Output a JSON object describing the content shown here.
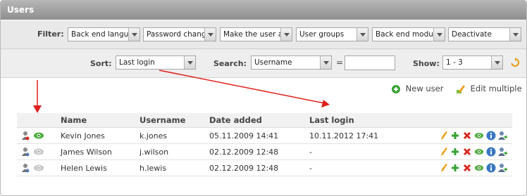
{
  "window": {
    "title": "Users"
  },
  "filter": {
    "label": "Filter:",
    "selects": [
      {
        "value": "Back end langua"
      },
      {
        "value": "Password change"
      },
      {
        "value": "Make the user a"
      },
      {
        "value": "User groups"
      },
      {
        "value": "Back end module"
      },
      {
        "value": "Deactivate"
      }
    ]
  },
  "sort": {
    "label": "Sort:",
    "value": "Last login"
  },
  "search": {
    "label": "Search:",
    "field_value": "Username",
    "equals": "=",
    "query": ""
  },
  "show": {
    "label": "Show:",
    "value": "1 - 3"
  },
  "actions": {
    "new_user": "New user",
    "edit_multiple": "Edit multiple"
  },
  "table": {
    "headers": [
      "Name",
      "Username",
      "Date added",
      "Last login"
    ],
    "rows": [
      {
        "name": "Kevin Jones",
        "username": "k.jones",
        "date_added": "05.11.2009 14:41",
        "last_login": "10.11.2012 17:41",
        "visible": true
      },
      {
        "name": "James Wilson",
        "username": "j.wilson",
        "date_added": "02.12.2009 12:48",
        "last_login": "-",
        "visible": false
      },
      {
        "name": "Helen Lewis",
        "username": "h.lewis",
        "date_added": "02.12.2009 12:48",
        "last_login": "-",
        "visible": false
      }
    ]
  },
  "colors": {
    "arrow": "#e0201c",
    "add": "#3aa335",
    "delete": "#d62b20",
    "info": "#3a76c4",
    "edit": "#e8a21a"
  }
}
